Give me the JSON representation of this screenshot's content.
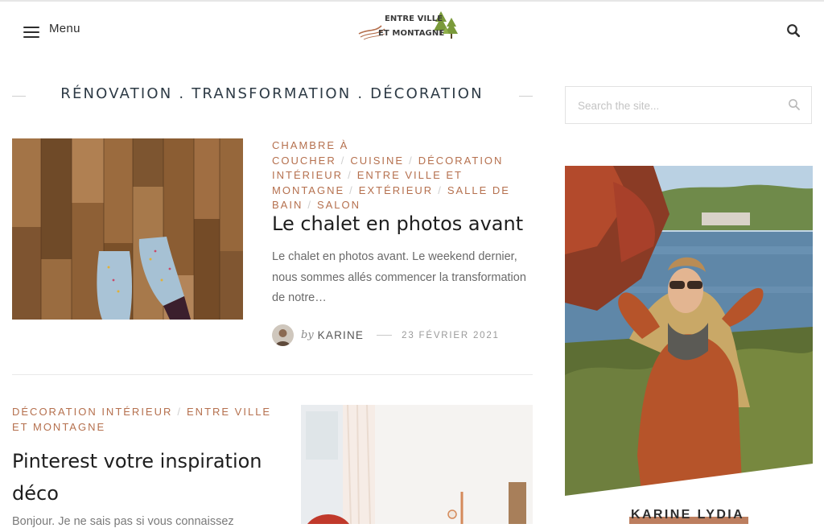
{
  "header": {
    "menu_label": "Menu",
    "logo_line1": "ENTRE VILLE",
    "logo_line2": "ET MONTAGNE",
    "search_icon": "search-icon"
  },
  "section_title": "RÉNOVATION . TRANSFORMATION . DÉCORATION",
  "posts": [
    {
      "categories": [
        "CHAMBRE À COUCHER",
        "CUISINE",
        "DÉCORATION INTÉRIEUR",
        "ENTRE VILLE ET MONTAGNE",
        "EXTÉRIEUR",
        "SALLE DE BAIN",
        "SALON"
      ],
      "title": "Le chalet en photos avant",
      "excerpt": "Le chalet en photos avant. Le weekend dernier, nous sommes allés commencer la transformation de notre…",
      "by": "by",
      "author": "KARINE",
      "date": "23 FÉVRIER 2021"
    },
    {
      "categories": [
        "DÉCORATION INTÉRIEUR",
        "ENTRE VILLE ET MONTAGNE"
      ],
      "title": "Pinterest votre inspiration déco",
      "excerpt": "Bonjour. Je ne sais pas si vous connaissez"
    }
  ],
  "sidebar": {
    "search_placeholder": "Search the site...",
    "about_name": "KARINE LYDIA"
  },
  "colors": {
    "accent": "#b5704e",
    "text": "#2d2d2d",
    "muted": "#6a6a6a"
  }
}
